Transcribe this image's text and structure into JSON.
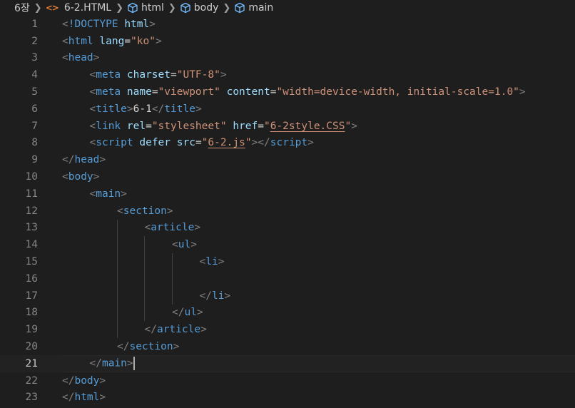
{
  "breadcrumb": {
    "items": [
      {
        "label": "6장",
        "icon": "none"
      },
      {
        "label": "6-2.HTML",
        "icon": "html-file-icon"
      },
      {
        "label": "html",
        "icon": "element-cube-icon"
      },
      {
        "label": "body",
        "icon": "element-cube-icon"
      },
      {
        "label": "main",
        "icon": "element-cube-icon"
      }
    ]
  },
  "colors": {
    "background": "#1e1e1e",
    "tag": "#569cd6",
    "attribute": "#9cdcfe",
    "string": "#ce9178",
    "punctuation": "#808080",
    "text": "#d4d4d4",
    "line_number": "#858585"
  },
  "editor": {
    "current_line": 21,
    "lines": [
      {
        "n": "1",
        "indent": 0,
        "tokens": [
          [
            "punct",
            "<"
          ],
          [
            "tag",
            "!DOCTYPE"
          ],
          [
            "text",
            " "
          ],
          [
            "attr",
            "html"
          ],
          [
            "punct",
            ">"
          ]
        ]
      },
      {
        "n": "2",
        "indent": 0,
        "tokens": [
          [
            "punct",
            "<"
          ],
          [
            "tag",
            "html"
          ],
          [
            "text",
            " "
          ],
          [
            "attr",
            "lang"
          ],
          [
            "text",
            "="
          ],
          [
            "str",
            "\"ko\""
          ],
          [
            "punct",
            ">"
          ]
        ]
      },
      {
        "n": "3",
        "indent": 0,
        "tokens": [
          [
            "punct",
            "<"
          ],
          [
            "tag",
            "head"
          ],
          [
            "punct",
            ">"
          ]
        ]
      },
      {
        "n": "4",
        "indent": 1,
        "tokens": [
          [
            "punct",
            "<"
          ],
          [
            "tag",
            "meta"
          ],
          [
            "text",
            " "
          ],
          [
            "attr",
            "charset"
          ],
          [
            "text",
            "="
          ],
          [
            "str",
            "\"UTF-8\""
          ],
          [
            "punct",
            ">"
          ]
        ]
      },
      {
        "n": "5",
        "indent": 1,
        "tokens": [
          [
            "punct",
            "<"
          ],
          [
            "tag",
            "meta"
          ],
          [
            "text",
            " "
          ],
          [
            "attr",
            "name"
          ],
          [
            "text",
            "="
          ],
          [
            "str",
            "\"viewport\""
          ],
          [
            "text",
            " "
          ],
          [
            "attr",
            "content"
          ],
          [
            "text",
            "="
          ],
          [
            "str",
            "\"width=device-width, initial-scale=1.0\""
          ],
          [
            "punct",
            ">"
          ]
        ]
      },
      {
        "n": "6",
        "indent": 1,
        "tokens": [
          [
            "punct",
            "<"
          ],
          [
            "tag",
            "title"
          ],
          [
            "punct",
            ">"
          ],
          [
            "text",
            "6-1"
          ],
          [
            "punct",
            "</"
          ],
          [
            "tag",
            "title"
          ],
          [
            "punct",
            ">"
          ]
        ]
      },
      {
        "n": "7",
        "indent": 1,
        "tokens": [
          [
            "punct",
            "<"
          ],
          [
            "tag",
            "link"
          ],
          [
            "text",
            " "
          ],
          [
            "attr",
            "rel"
          ],
          [
            "text",
            "="
          ],
          [
            "str",
            "\"stylesheet\""
          ],
          [
            "text",
            " "
          ],
          [
            "attr",
            "href"
          ],
          [
            "text",
            "="
          ],
          [
            "str",
            "\""
          ],
          [
            "link",
            "6-2style.CSS"
          ],
          [
            "str",
            "\""
          ],
          [
            "punct",
            ">"
          ]
        ]
      },
      {
        "n": "8",
        "indent": 1,
        "tokens": [
          [
            "punct",
            "<"
          ],
          [
            "tag",
            "script"
          ],
          [
            "text",
            " "
          ],
          [
            "attr",
            "defer"
          ],
          [
            "text",
            " "
          ],
          [
            "attr",
            "src"
          ],
          [
            "text",
            "="
          ],
          [
            "str",
            "\""
          ],
          [
            "link",
            "6-2.js"
          ],
          [
            "str",
            "\""
          ],
          [
            "punct",
            "></"
          ],
          [
            "tag",
            "script"
          ],
          [
            "punct",
            ">"
          ]
        ]
      },
      {
        "n": "9",
        "indent": 0,
        "tokens": [
          [
            "punct",
            "</"
          ],
          [
            "tag",
            "head"
          ],
          [
            "punct",
            ">"
          ]
        ]
      },
      {
        "n": "10",
        "indent": 0,
        "tokens": [
          [
            "punct",
            "<"
          ],
          [
            "tag",
            "body"
          ],
          [
            "punct",
            ">"
          ]
        ]
      },
      {
        "n": "11",
        "indent": 1,
        "tokens": [
          [
            "punct",
            "<"
          ],
          [
            "tag",
            "main"
          ],
          [
            "punct",
            ">"
          ]
        ]
      },
      {
        "n": "12",
        "indent": 2,
        "tokens": [
          [
            "punct",
            "<"
          ],
          [
            "tag",
            "section"
          ],
          [
            "punct",
            ">"
          ]
        ]
      },
      {
        "n": "13",
        "indent": 3,
        "tokens": [
          [
            "punct",
            "<"
          ],
          [
            "tag",
            "article"
          ],
          [
            "punct",
            ">"
          ]
        ]
      },
      {
        "n": "14",
        "indent": 4,
        "tokens": [
          [
            "punct",
            "<"
          ],
          [
            "tag",
            "ul"
          ],
          [
            "punct",
            ">"
          ]
        ]
      },
      {
        "n": "15",
        "indent": 5,
        "tokens": [
          [
            "punct",
            "<"
          ],
          [
            "tag",
            "li"
          ],
          [
            "punct",
            ">"
          ]
        ]
      },
      {
        "n": "16",
        "indent": 0,
        "tokens": []
      },
      {
        "n": "17",
        "indent": 5,
        "tokens": [
          [
            "punct",
            "</"
          ],
          [
            "tag",
            "li"
          ],
          [
            "punct",
            ">"
          ]
        ]
      },
      {
        "n": "18",
        "indent": 4,
        "tokens": [
          [
            "punct",
            "</"
          ],
          [
            "tag",
            "ul"
          ],
          [
            "punct",
            ">"
          ]
        ]
      },
      {
        "n": "19",
        "indent": 3,
        "tokens": [
          [
            "punct",
            "</"
          ],
          [
            "tag",
            "article"
          ],
          [
            "punct",
            ">"
          ]
        ]
      },
      {
        "n": "20",
        "indent": 2,
        "tokens": [
          [
            "punct",
            "</"
          ],
          [
            "tag",
            "section"
          ],
          [
            "punct",
            ">"
          ]
        ]
      },
      {
        "n": "21",
        "indent": 1,
        "tokens": [
          [
            "punct",
            "</"
          ],
          [
            "tag",
            "main"
          ],
          [
            "punct",
            ">"
          ]
        ]
      },
      {
        "n": "22",
        "indent": 0,
        "tokens": [
          [
            "punct",
            "</"
          ],
          [
            "tag",
            "body"
          ],
          [
            "punct",
            ">"
          ]
        ]
      },
      {
        "n": "23",
        "indent": 0,
        "tokens": [
          [
            "punct",
            "</"
          ],
          [
            "tag",
            "html"
          ],
          [
            "punct",
            ">"
          ]
        ]
      }
    ]
  }
}
